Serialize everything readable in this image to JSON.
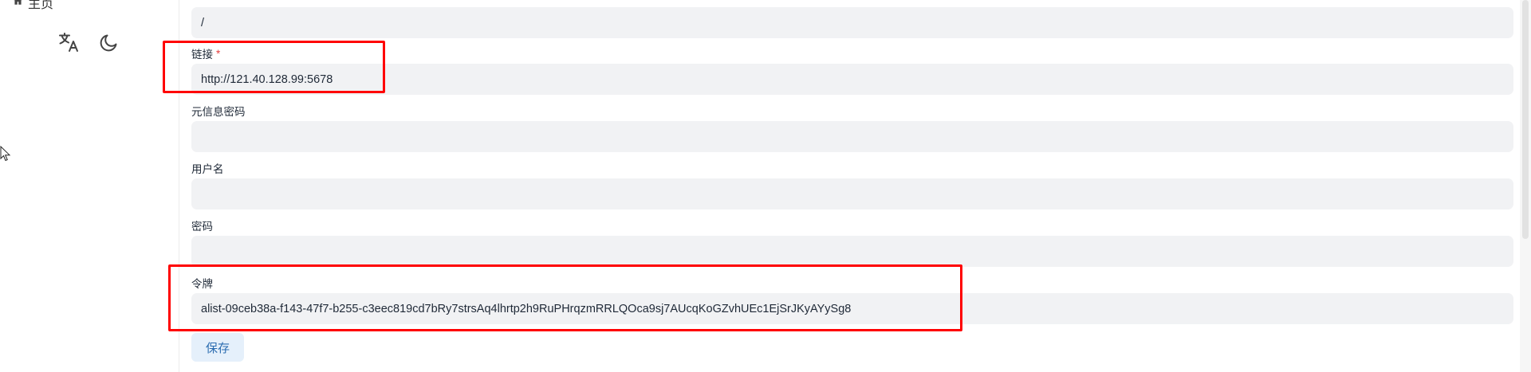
{
  "sidebar": {
    "home_label": "主页",
    "icons": {
      "home": "home-icon",
      "language": "translate-icon",
      "theme": "moon-icon"
    }
  },
  "form": {
    "path": {
      "value": "/"
    },
    "url": {
      "label": "链接",
      "required_mark": "*",
      "value": "http://121.40.128.99:5678"
    },
    "meta_password": {
      "label": "元信息密码",
      "value": ""
    },
    "username": {
      "label": "用户名",
      "value": ""
    },
    "password": {
      "label": "密码",
      "value": ""
    },
    "token": {
      "label": "令牌",
      "value": "alist-09ceb38a-f143-47f7-b255-c3eec819cd7bRy7strsAq4lhrtp2h9RuPHrqzmRRLQOca9sj7AUcqKoGZvhUEc1EjSrJKyAYySg8"
    },
    "save_label": "保存"
  },
  "colors": {
    "input_bg": "#f1f2f4",
    "accent": "#2b6cb0",
    "button_bg": "#e5f0fb",
    "highlight": "#ff0000",
    "required": "#e53e3e"
  }
}
